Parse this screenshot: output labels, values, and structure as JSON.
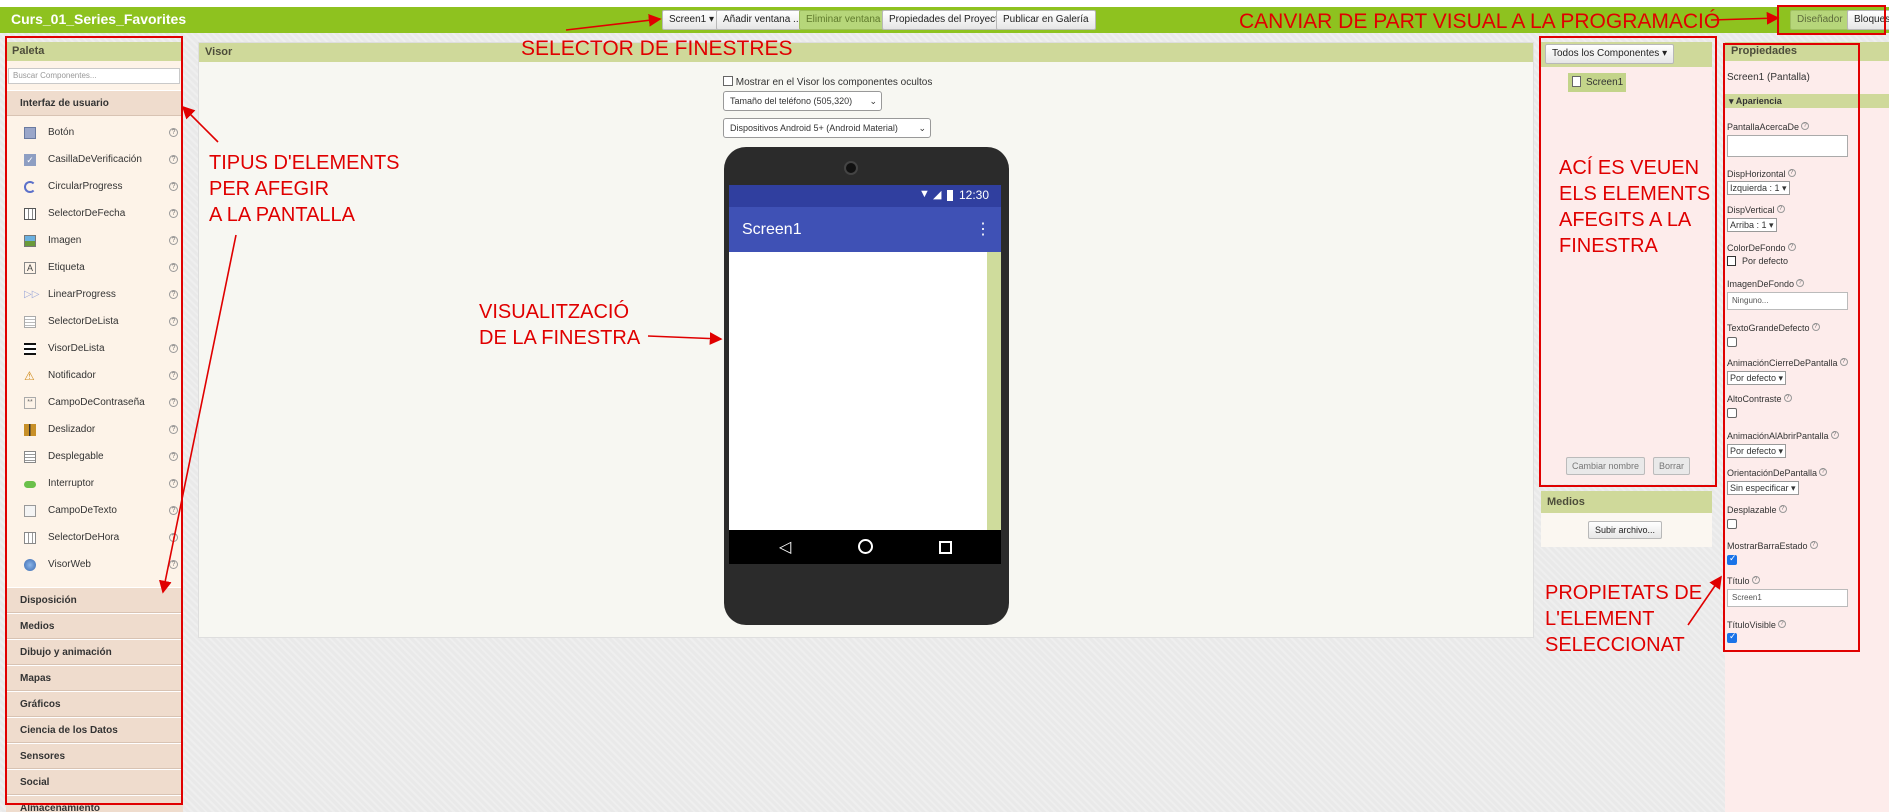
{
  "topbar": {
    "app_title": "Curs_01_Series_Favorites",
    "buttons": {
      "screen_select": "Screen1 ▾",
      "add_screen": "Añadir ventana ...",
      "remove_screen": "Eliminar ventana",
      "project_props": "Propiedades del Proyecto",
      "publish": "Publicar en Galería",
      "designer": "Diseñador",
      "blocks": "Bloques"
    }
  },
  "palette": {
    "title": "Paleta",
    "search_placeholder": "Buscar Componentes...",
    "ui_category": "Interfaz de usuario",
    "components": [
      {
        "label": "Botón",
        "icon": "button-icon"
      },
      {
        "label": "CasillaDeVerificación",
        "icon": "checkbox-icon"
      },
      {
        "label": "CircularProgress",
        "icon": "circular-progress-icon"
      },
      {
        "label": "SelectorDeFecha",
        "icon": "date-picker-icon"
      },
      {
        "label": "Imagen",
        "icon": "image-icon"
      },
      {
        "label": "Etiqueta",
        "icon": "label-icon"
      },
      {
        "label": "LinearProgress",
        "icon": "linear-progress-icon"
      },
      {
        "label": "SelectorDeLista",
        "icon": "list-picker-icon"
      },
      {
        "label": "VisorDeLista",
        "icon": "list-view-icon"
      },
      {
        "label": "Notificador",
        "icon": "notifier-icon"
      },
      {
        "label": "CampoDeContraseña",
        "icon": "password-icon"
      },
      {
        "label": "Deslizador",
        "icon": "slider-icon"
      },
      {
        "label": "Desplegable",
        "icon": "spinner-icon"
      },
      {
        "label": "Interruptor",
        "icon": "switch-icon"
      },
      {
        "label": "CampoDeTexto",
        "icon": "textbox-icon"
      },
      {
        "label": "SelectorDeHora",
        "icon": "time-picker-icon"
      },
      {
        "label": "VisorWeb",
        "icon": "webviewer-icon"
      }
    ],
    "categories": [
      "Disposición",
      "Medios",
      "Dibujo y animación",
      "Mapas",
      "Gráficos",
      "Ciencia de los Datos",
      "Sensores",
      "Social",
      "Almacenamiento"
    ]
  },
  "viewer": {
    "title": "Visor",
    "show_hidden": "Mostrar en el Visor los componentes ocultos",
    "phone_size": "Tamaño del teléfono (505,320)",
    "device": "Dispositivos Android 5+ (Android Material)",
    "status_time": "12:30",
    "screen_title": "Screen1"
  },
  "components_panel": {
    "dropdown": "Todos los Componentes ▾",
    "tree_item": "Screen1",
    "rename": "Cambiar nombre",
    "delete": "Borrar"
  },
  "media_panel": {
    "title": "Medios",
    "upload": "Subir archivo..."
  },
  "properties": {
    "title": "Propiedades",
    "subject": "Screen1 (Pantalla)",
    "section": "Apariencia",
    "about": "PantallaAcercaDe",
    "align_h": "DispHorizontal",
    "align_h_value": "Izquierda : 1 ▾",
    "align_v": "DispVertical",
    "align_v_value": "Arriba : 1 ▾",
    "bg_color": "ColorDeFondo",
    "bg_color_value": "Por defecto",
    "bg_image": "ImagenDeFondo",
    "bg_image_value": "Ninguno...",
    "big_text": "TextoGrandeDefecto",
    "close_anim": "AnimaciónCierreDePantalla",
    "close_anim_value": "Por defecto ▾",
    "high_contrast": "AltoContraste",
    "open_anim": "AnimaciónAlAbrirPantalla",
    "open_anim_value": "Por defecto ▾",
    "orientation": "OrientaciónDePantalla",
    "orientation_value": "Sin especificar ▾",
    "scrollable": "Desplazable",
    "show_status": "MostrarBarraEstado",
    "title_label": "Título",
    "title_value": "Screen1",
    "title_visible": "TítuloVisible"
  },
  "annotations": {
    "screen_selector": "SELECTOR DE FINESTRES",
    "switch_view": "CANVIAR DE PART VISUAL A LA PROGRAMACIÓ",
    "element_types": [
      "TIPUS D'ELEMENTS",
      "PER AFEGIR",
      "A LA PANTALLA"
    ],
    "visualization": [
      "VISUALITZACIÓ",
      "DE LA FINESTRA"
    ],
    "added_elements": [
      "ACÍ ES VEUEN",
      "ELS ELEMENTS",
      "AFEGITS A LA",
      "FINESTRA"
    ],
    "properties": [
      "PROPIETATS DE",
      "L'ELEMENT",
      "SELECCIONAT"
    ]
  }
}
